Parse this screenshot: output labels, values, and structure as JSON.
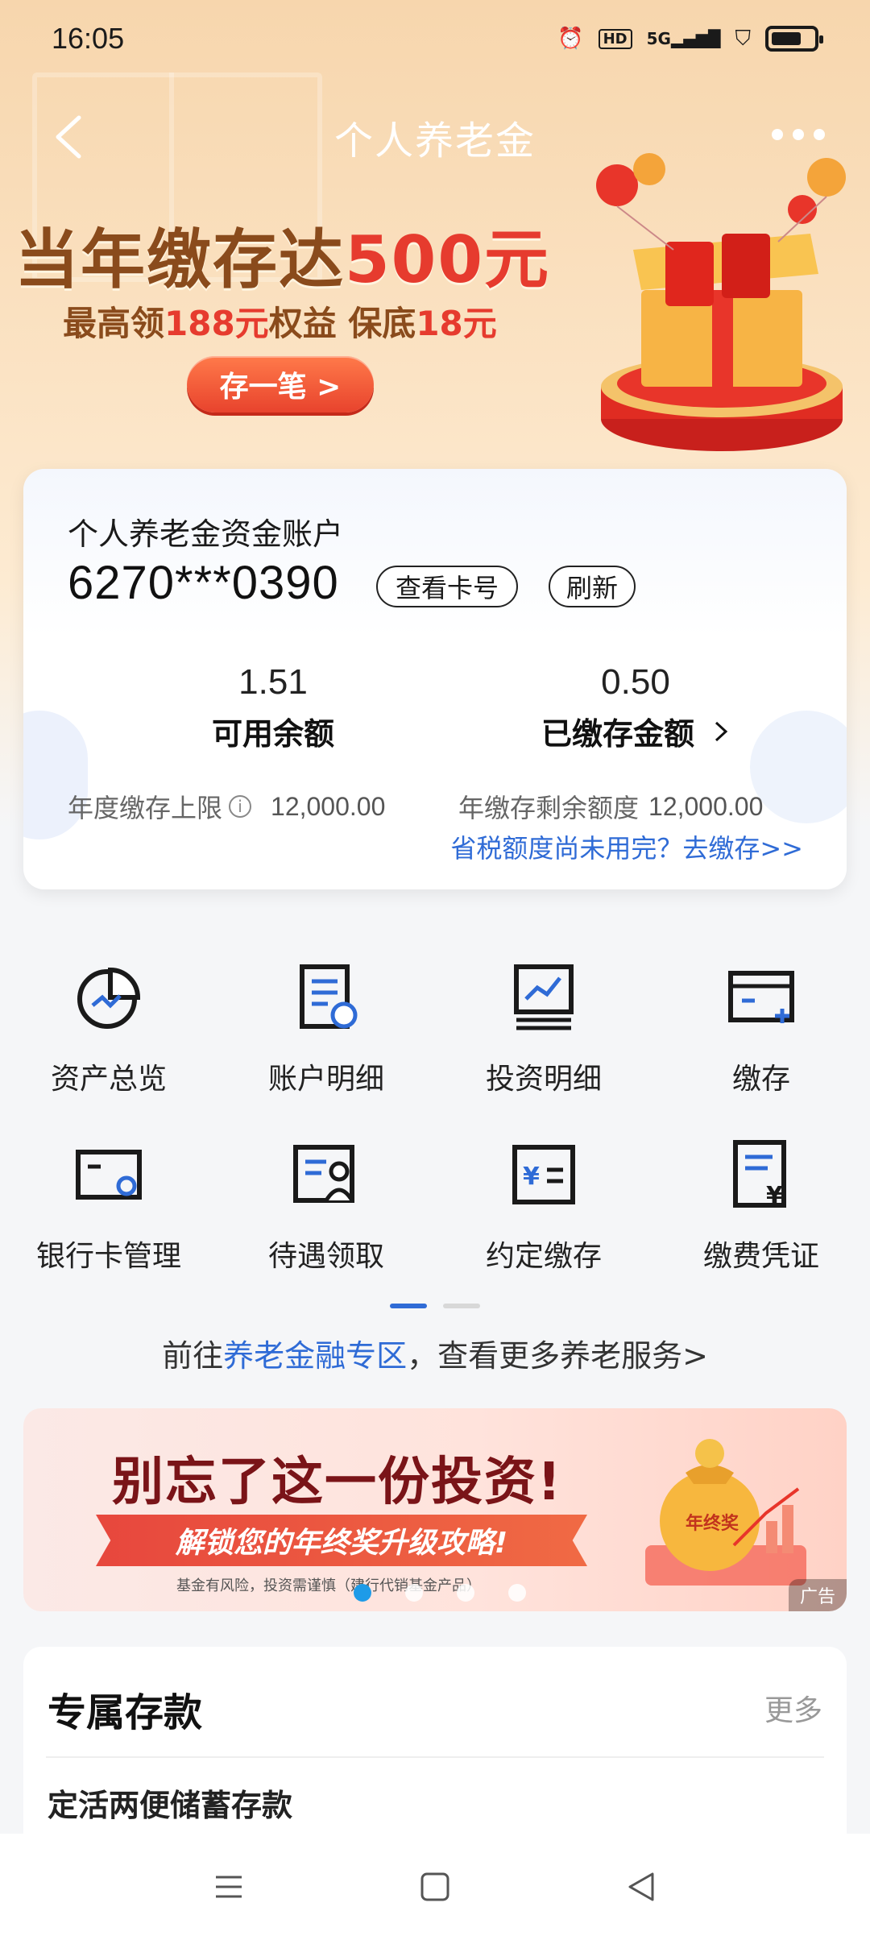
{
  "status_bar": {
    "time": "16:05",
    "icons": [
      "alarm-icon",
      "hd-icon",
      "5g-signal-icon",
      "shield-icon",
      "battery-icon"
    ],
    "hd_label": "HD",
    "net_label": "5G"
  },
  "nav": {
    "title": "个人养老金"
  },
  "promo": {
    "headline_prefix": "当年缴存达",
    "headline_amount": "500元",
    "sub_prefix": "最高领",
    "sub_amount1": "188元",
    "sub_mid": "权益 保底",
    "sub_amount2": "18元",
    "button": "存一笔 >"
  },
  "account_card": {
    "title": "个人养老金资金账户",
    "account_number": "6270***0390",
    "view_card_button": "查看卡号",
    "refresh_button": "刷新",
    "available_value": "1.51",
    "available_label": "可用余额",
    "deposited_value": "0.50",
    "deposited_label": "已缴存金额",
    "annual_limit_label": "年度缴存上限",
    "annual_limit_value": "12,000.00",
    "remaining_label": "年缴存剩余额度",
    "remaining_value": "12,000.00",
    "tax_link": "省税额度尚未用完？去缴存>>"
  },
  "services": [
    {
      "label": "资产总览",
      "icon": "asset-overview-icon"
    },
    {
      "label": "账户明细",
      "icon": "account-detail-icon"
    },
    {
      "label": "投资明细",
      "icon": "investment-detail-icon"
    },
    {
      "label": "缴存",
      "icon": "deposit-icon"
    },
    {
      "label": "银行卡管理",
      "icon": "bank-card-icon"
    },
    {
      "label": "待遇领取",
      "icon": "benefit-claim-icon"
    },
    {
      "label": "约定缴存",
      "icon": "scheduled-deposit-icon"
    },
    {
      "label": "缴费凭证",
      "icon": "payment-receipt-icon"
    }
  ],
  "goto": {
    "prefix": "前往",
    "link": "养老金融专区",
    "suffix": "，查看更多养老服务>"
  },
  "ad": {
    "title": "别忘了这一份投资!",
    "ribbon": "解锁您的年终奖升级攻略!",
    "note": "基金有风险，投资需谨慎（建行代销基金产品）",
    "bag_label": "年终奖",
    "tag": "广告"
  },
  "deposit_section": {
    "title": "专属存款",
    "more": "更多",
    "first_item": "定活两便储蓄存款"
  },
  "colors": {
    "accent_blue": "#2f6bd6",
    "promo_red": "#e63b2e",
    "promo_brown": "#8a4b1c"
  }
}
